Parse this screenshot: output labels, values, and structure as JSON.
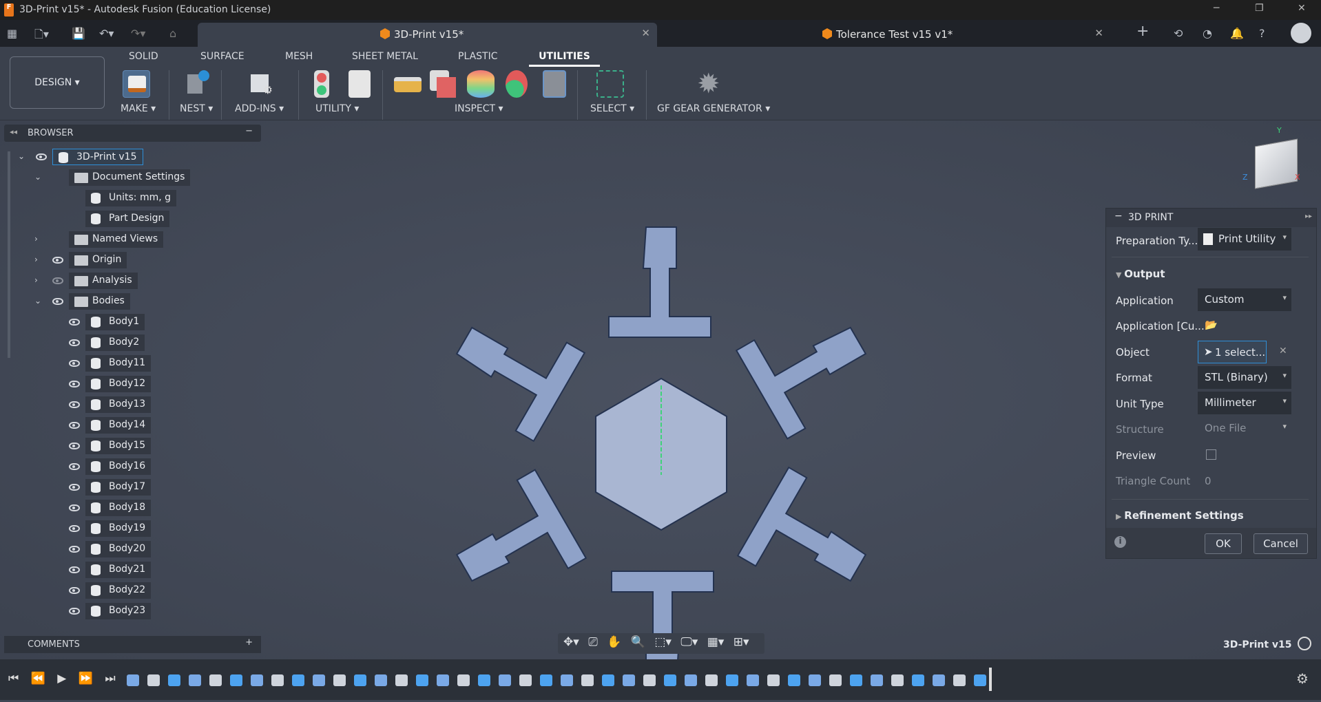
{
  "window": {
    "title": "3D-Print v15* - Autodesk Fusion (Education License)",
    "logo": "F"
  },
  "tabs": [
    {
      "label": "3D-Print v15*",
      "active": true
    },
    {
      "label": "Tolerance Test v15 v1*",
      "active": false
    }
  ],
  "ribbon": {
    "workspace": "DESIGN",
    "tabs": [
      "SOLID",
      "SURFACE",
      "MESH",
      "SHEET METAL",
      "PLASTIC",
      "UTILITIES"
    ],
    "active_tab": "UTILITIES",
    "groups": [
      "MAKE",
      "NEST",
      "ADD-INS",
      "UTILITY",
      "INSPECT",
      "SELECT",
      "GF GEAR GENERATOR"
    ]
  },
  "browser": {
    "title": "BROWSER",
    "root": "3D-Print v15",
    "items": [
      "Document Settings",
      "Units: mm, g",
      "Part Design",
      "Named Views",
      "Origin",
      "Analysis",
      "Bodies"
    ],
    "bodies": [
      "Body1",
      "Body2",
      "Body11",
      "Body12",
      "Body13",
      "Body14",
      "Body15",
      "Body16",
      "Body17",
      "Body18",
      "Body19",
      "Body20",
      "Body21",
      "Body22",
      "Body23"
    ]
  },
  "comments": {
    "title": "COMMENTS"
  },
  "panel": {
    "title": "3D PRINT",
    "prep_label": "Preparation Ty...",
    "prep_value": "Print Utility",
    "output": "Output",
    "application_label": "Application",
    "application_value": "Custom",
    "app_path_label": "Application [Cu...",
    "object_label": "Object",
    "object_value": "1 select...",
    "format_label": "Format",
    "format_value": "STL (Binary)",
    "unit_label": "Unit Type",
    "unit_value": "Millimeter",
    "structure_label": "Structure",
    "structure_value": "One File",
    "preview_label": "Preview",
    "preview_checked": false,
    "triangle_label": "Triangle Count",
    "triangle_value": "0",
    "refinement": "Refinement Settings",
    "ok": "OK",
    "cancel": "Cancel"
  },
  "viewport": {
    "doc_name": "3D-Print v15"
  },
  "colors": {
    "accent": "#0696d7",
    "body": "#8b9ec4",
    "orange": "#f08a1c"
  }
}
